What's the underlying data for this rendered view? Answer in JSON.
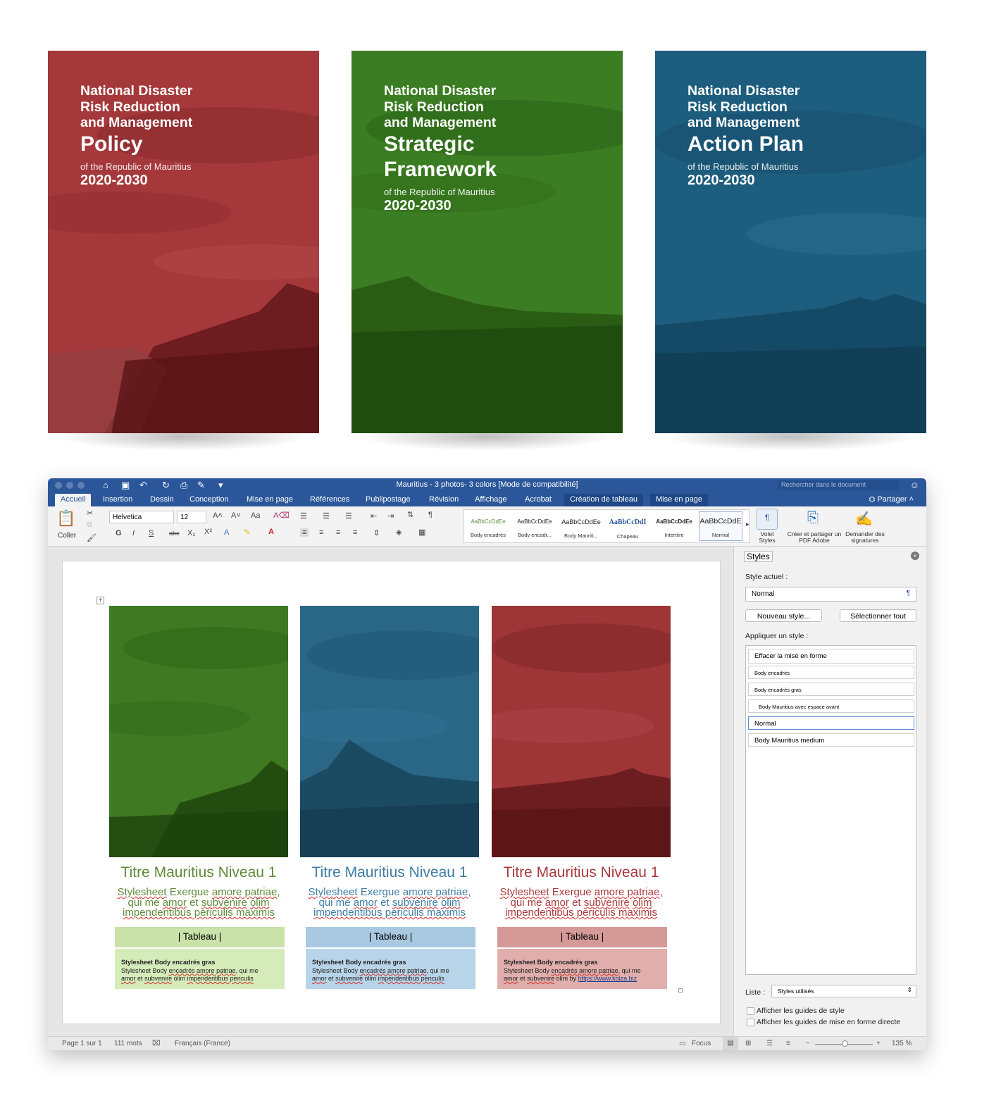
{
  "covers": [
    {
      "lines": [
        "National Disaster",
        "Risk Reduction",
        "and Management"
      ],
      "title": "Policy",
      "subtitle": "of the Republic of Mauritius",
      "years": "2020-2030",
      "color": "#a5383a"
    },
    {
      "lines": [
        "National Disaster",
        "Risk Reduction",
        "and Management"
      ],
      "title": "Strategic Framework",
      "subtitle": "of the Republic of Mauritius",
      "years": "2020-2030",
      "color": "#3b7d22"
    },
    {
      "lines": [
        "National Disaster",
        "Risk Reduction",
        "and Management"
      ],
      "title": "Action Plan",
      "subtitle": "of the Republic of Mauritius",
      "years": "2020-2030",
      "color": "#1d5d7e"
    }
  ],
  "word": {
    "doc_title": "Mauritius - 3 photos- 3 colors [Mode de compatibilité]",
    "search_placeholder": "Rechercher dans le document",
    "share": "Partager",
    "tabs": [
      "Accueil",
      "Insertion",
      "Dessin",
      "Conception",
      "Mise en page",
      "Références",
      "Publipostage",
      "Révision",
      "Affichage",
      "Acrobat",
      "Création de tableau",
      "Mise en page"
    ],
    "ribbon": {
      "paste": "Coller",
      "font": "Helvetica",
      "size": "12",
      "styles": [
        {
          "sample": "AaBbCcDdEe",
          "label": "Body encadrés"
        },
        {
          "sample": "AaBbCcDdEe",
          "label": "Body encadr..."
        },
        {
          "sample": "AaBbCcDdEe",
          "label": "Body Mauriti..."
        },
        {
          "sample": "AaBbCcDdI",
          "label": "Chapeau"
        },
        {
          "sample": "AaBbCcDdEe",
          "label": "Intertitre"
        },
        {
          "sample": "AaBbCcDdE",
          "label": "Normal"
        }
      ],
      "volet_styles": "Volet Styles",
      "create_pdf": "Créer et partager un PDF Adobe",
      "signatures": "Demander des signatures"
    },
    "columns": [
      {
        "heading": "Titre Mauritius Niveau 1",
        "ex1": "Stylesheet",
        "ex2": "Exergue",
        "ex3": "amore patriae,",
        "ex4": "qui me",
        "ex5": "amor",
        "ex6": "et",
        "ex7": "subvenire",
        "ex8": "olim",
        "ex9": "impendentibus periculis maximis",
        "table_head": "| Tableau |",
        "body_bold": "Stylesheet Body encadrés gras",
        "body_1": "Stylesheet Body",
        "body_2": "encadrés amore patriae,",
        "body_3": "qui me",
        "body_4": "amor",
        "body_5": "et",
        "body_6": "subvenire",
        "body_7": "olim",
        "body_8": "impendentibus periculis",
        "head_color": "#5e8a3a",
        "table_color": "#c9e2a9",
        "body_color": "#d5ebb9"
      },
      {
        "heading": "Titre Mauritius Niveau 1",
        "ex1": "Stylesheet",
        "ex2": "Exergue",
        "ex3": "amore patriae,",
        "ex4": "qui me",
        "ex5": "amor",
        "ex6": "et",
        "ex7": "subvenire",
        "ex8": "olim",
        "ex9": "impendentibus periculis maximis",
        "table_head": "| Tableau |",
        "body_bold": "Stylesheet Body encadrés gras",
        "body_1": "Stylesheet Body",
        "body_2": "encadrés amore patriae,",
        "body_3": "qui me",
        "body_4": "amor",
        "body_5": "et",
        "body_6": "subvenire",
        "body_7": "olim",
        "body_8": "impendentibus periculis",
        "head_color": "#3d7da3",
        "table_color": "#a8c9e0",
        "body_color": "#b8d4e8"
      },
      {
        "heading": "Titre Mauritius Niveau 1",
        "ex1": "Stylesheet",
        "ex2": "Exergue",
        "ex3": "amore patriae,",
        "ex4": "qui me",
        "ex5": "amor",
        "ex6": "et",
        "ex7": "subvenire",
        "ex8": "olim",
        "ex9": "impendentibus periculis maximis",
        "table_head": "| Tableau |",
        "body_bold": "Stylesheet Body encadrés gras",
        "body_1": "Stylesheet Body",
        "body_2": "encadrés amore patriae,",
        "body_3": "qui me",
        "body_4": "amor",
        "body_5": "et",
        "body_6": "subvenire",
        "body_7": "olim by",
        "body_8": "https://www.kolza.biz",
        "head_color": "#a8393c",
        "table_color": "#d59a98",
        "body_color": "#e0aeac"
      }
    ],
    "styles_panel": {
      "title": "Styles",
      "current_label": "Style actuel :",
      "current_value": "Normal",
      "new_style": "Nouveau style...",
      "select_all": "Sélectionner tout",
      "apply_label": "Appliquer un style :",
      "items": [
        "Effacer la mise en forme",
        "Body encadrés",
        "Body encadrés gras",
        "Body Mauritius avec espace avant",
        "Normal",
        "Body Mauritius medium"
      ],
      "list_label": "Liste :",
      "list_value": "Styles utilisés",
      "check1": "Afficher les guides de style",
      "check2": "Afficher les guides de mise en forme directe"
    },
    "status": {
      "page": "Page 1 sur 1",
      "words": "111 mots",
      "lang": "Français (France)",
      "focus": "Focus",
      "zoom": "135 %"
    }
  }
}
